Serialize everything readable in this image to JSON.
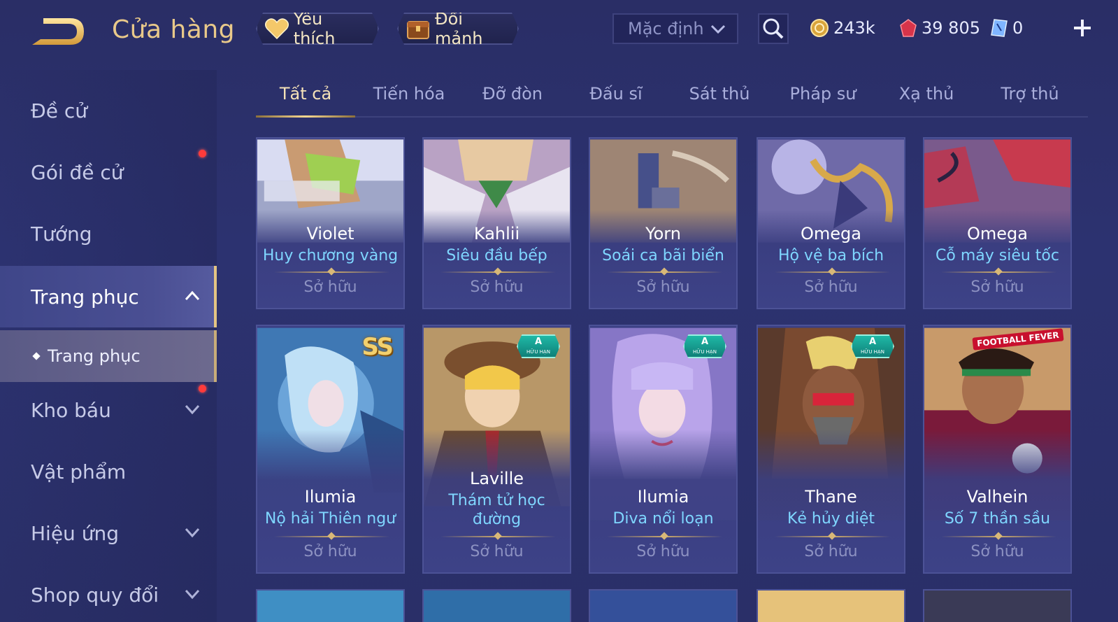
{
  "header": {
    "title": "Cửa hàng",
    "favorite_label": "Yêu thích",
    "exchange_label": "Đổi mảnh",
    "sort_value": "Mặc định",
    "currency": {
      "gold": "243k",
      "ruby": "39 805",
      "voucher": "0"
    }
  },
  "sidebar": {
    "items": [
      {
        "label": "Đề cử"
      },
      {
        "label": "Gói đề cử"
      },
      {
        "label": "Tướng"
      },
      {
        "label": "Trang phục"
      },
      {
        "label": "Trang phục"
      },
      {
        "label": "Kho báu"
      },
      {
        "label": "Vật phẩm"
      },
      {
        "label": "Hiệu ứng"
      },
      {
        "label": "Shop quy đổi"
      }
    ]
  },
  "tabs": [
    "Tất cả",
    "Tiến hóa",
    "Đỡ đòn",
    "Đấu sĩ",
    "Sát thủ",
    "Pháp sư",
    "Xạ thủ",
    "Trợ thủ"
  ],
  "cards": [
    {
      "hero": "Violet",
      "skin": "Huy chương vàng",
      "status": "Sở hữu"
    },
    {
      "hero": "Kahlii",
      "skin": "Siêu đầu bếp",
      "status": "Sở hữu"
    },
    {
      "hero": "Yorn",
      "skin": "Soái ca bãi biển",
      "status": "Sở hữu"
    },
    {
      "hero": "Omega",
      "skin": "Hộ vệ ba bích",
      "status": "Sở hữu"
    },
    {
      "hero": "Omega",
      "skin": "Cỗ máy siêu tốc",
      "status": "Sở hữu"
    },
    {
      "hero": "Ilumia",
      "skin": "Nộ hải Thiên ngư",
      "status": "Sở hữu",
      "badge": "SS"
    },
    {
      "hero": "Laville",
      "skin": "Thám tử học đường",
      "status": "Sở hữu",
      "badge": "A"
    },
    {
      "hero": "Ilumia",
      "skin": "Diva nổi loạn",
      "status": "Sở hữu",
      "badge": "A"
    },
    {
      "hero": "Thane",
      "skin": "Kẻ hủy diệt",
      "status": "Sở hữu",
      "badge": "A"
    },
    {
      "hero": "Valhein",
      "skin": "Số 7 thần sầu",
      "status": "Sở hữu",
      "badge": "FOOTBALL FEVER"
    }
  ],
  "badges": {
    "a_main": "A",
    "a_sub": "HỮU HẠN",
    "ss": "SS"
  },
  "colors": {
    "accent_gold": "#e9c98a",
    "skin_name": "#7fd6ff",
    "background": "#2c3270",
    "red_dot": "#ff3b3b"
  },
  "icons": [
    "back-arrow-icon",
    "heart-icon",
    "chest-icon",
    "chevron-down-icon",
    "search-icon",
    "gold-coin-icon",
    "ruby-icon",
    "voucher-icon",
    "plus-icon",
    "chevron-up-icon"
  ]
}
